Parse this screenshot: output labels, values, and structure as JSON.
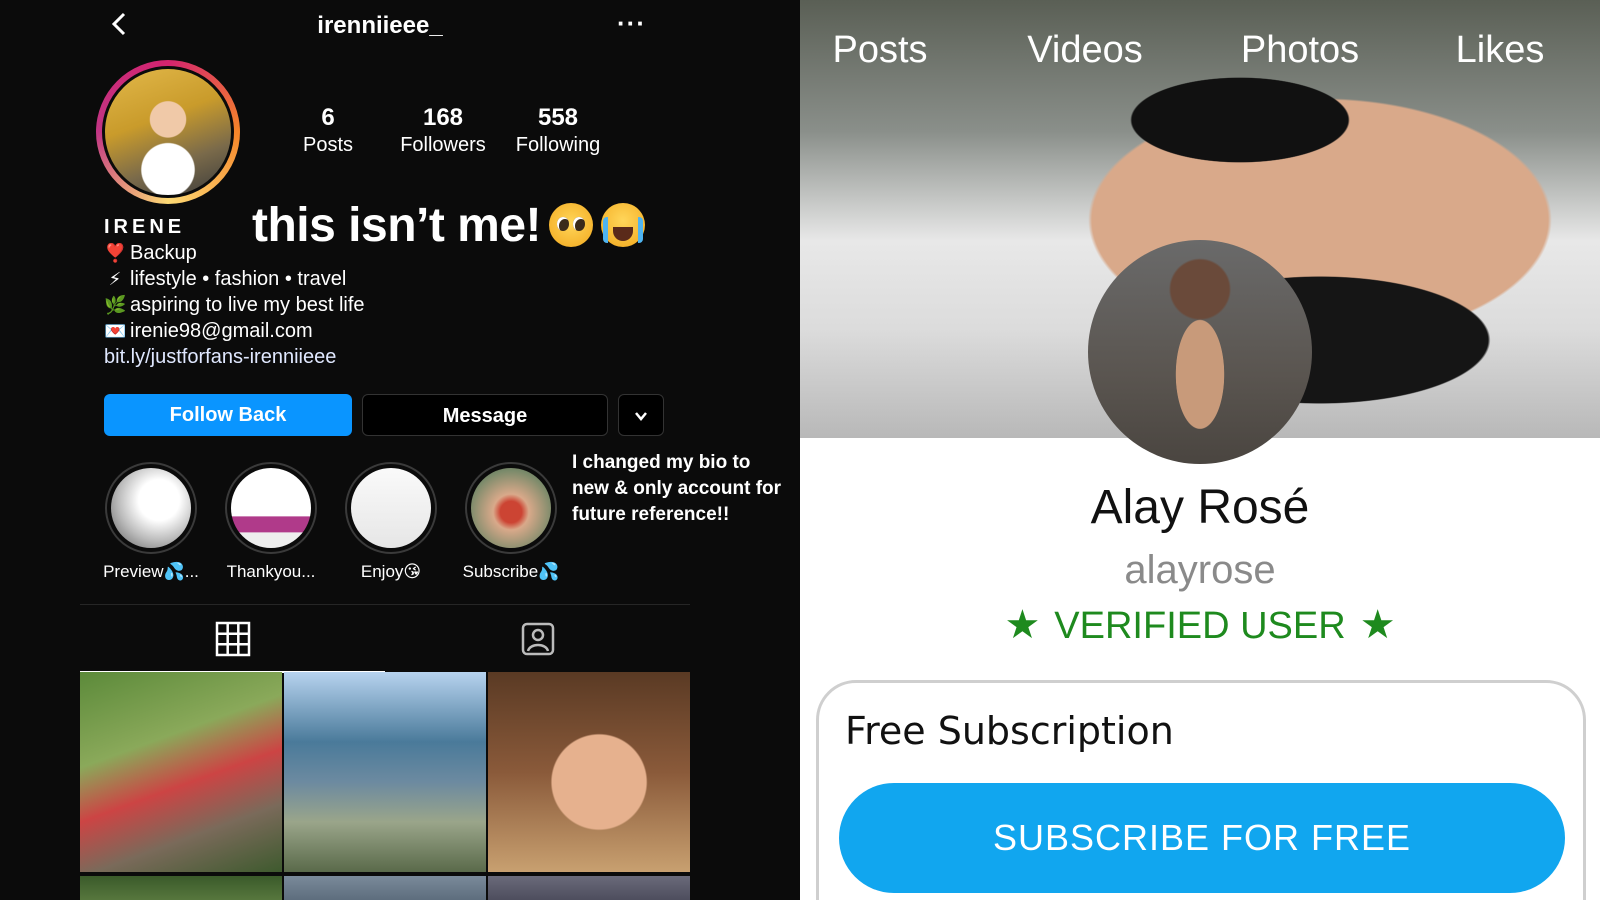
{
  "left": {
    "username": "irenniieee_",
    "more_glyph": "···",
    "stats": [
      {
        "num": "6",
        "label": "Posts"
      },
      {
        "num": "168",
        "label": "Followers"
      },
      {
        "num": "558",
        "label": "Following"
      }
    ],
    "overlay": "this isn’t me!",
    "bio": {
      "name": "IRENE",
      "lines": [
        {
          "icon": "❣️",
          "text": "Backup"
        },
        {
          "icon": "⚡",
          "text": "lifestyle • fashion • travel"
        },
        {
          "icon": "🌿",
          "text": "aspiring to live my best life"
        },
        {
          "icon": "💌",
          "text": "irenie98@gmail.com"
        }
      ],
      "link": "bit.ly/justforfans-irenniieee"
    },
    "buttons": {
      "follow": "Follow Back",
      "message": "Message"
    },
    "highlights": [
      {
        "label": "Preview💦..."
      },
      {
        "label": "Thankyou..."
      },
      {
        "label": "Enjoy😘"
      },
      {
        "label": "Subscribe💦"
      }
    ],
    "note": "I changed my bio to new & only account for future reference!!"
  },
  "right": {
    "stats": [
      {
        "label": "Posts"
      },
      {
        "label": "Videos"
      },
      {
        "label": "Photos"
      },
      {
        "label": "Likes"
      }
    ],
    "display_name": "Alay Rosé",
    "handle": "alayrose",
    "verified": "VERIFIED USER",
    "card_title": "Free Subscription",
    "subscribe": "SUBSCRIBE FOR FREE"
  },
  "colors": {
    "follow": "#0a95ff",
    "subscribe": "#11a6ef",
    "verified": "#1e8a1e"
  }
}
